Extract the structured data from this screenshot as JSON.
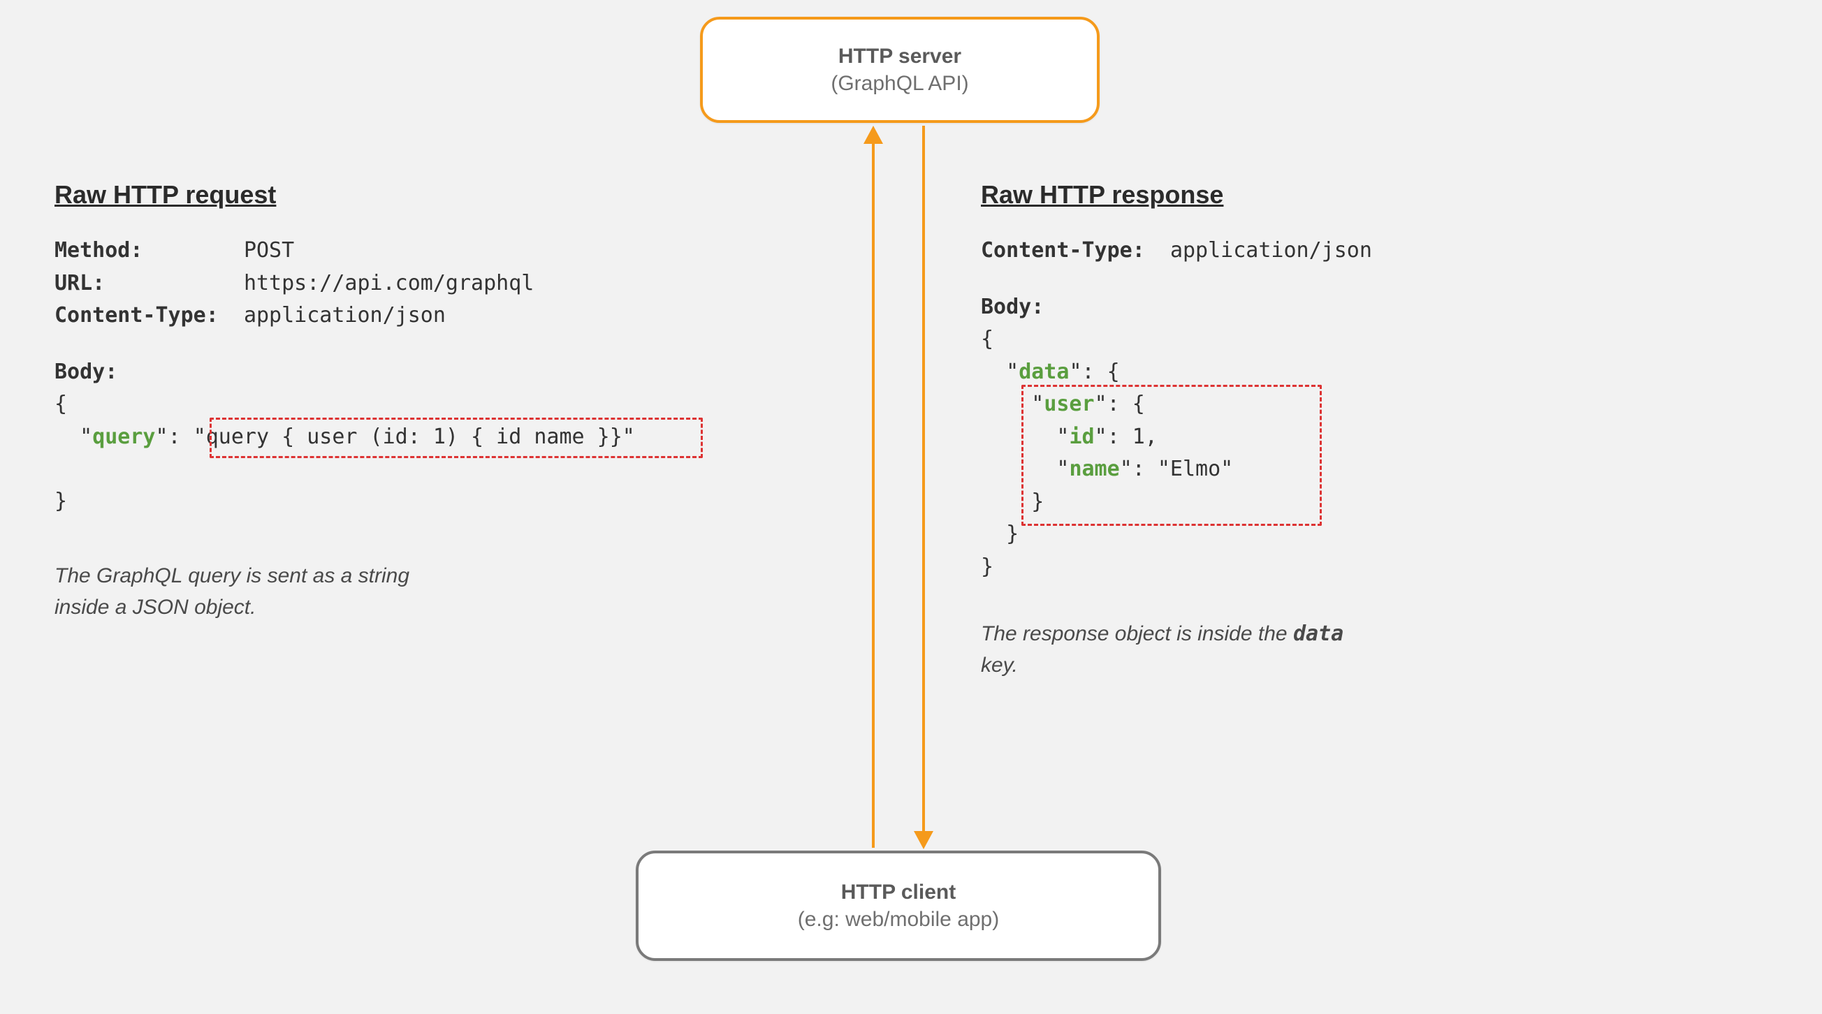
{
  "server": {
    "title": "HTTP server",
    "subtitle": "(GraphQL API)"
  },
  "client": {
    "title": "HTTP client",
    "subtitle": "(e.g: web/mobile app)"
  },
  "request": {
    "heading": "Raw HTTP request",
    "method_label": "Method:",
    "method_value": "POST",
    "url_label": "URL:",
    "url_value": "https://api.com/graphql",
    "content_type_label": "Content-Type:",
    "content_type_value": "application/json",
    "body_label": "Body:",
    "body_open": "{",
    "body_query_key_quote_open": "\"",
    "body_query_key": "query",
    "body_query_key_quote_close_colon": "\": ",
    "body_query_value": "\"query { user (id: 1) { id name }}\"",
    "body_close": "}",
    "caption_line1": "The GraphQL query is sent as a string",
    "caption_line2": "inside a JSON object."
  },
  "response": {
    "heading": "Raw HTTP response",
    "content_type_label": "Content-Type:",
    "content_type_value": "application/json",
    "body_label": "Body:",
    "l1": "{",
    "l2_pre_quote": "  \"",
    "l2_key": "data",
    "l2_post": "\": {",
    "l3_pre_quote": "    \"",
    "l3_key": "user",
    "l3_post": "\": {",
    "l4_pre_quote": "      \"",
    "l4_key": "id",
    "l4_post": "\": 1,",
    "l5_pre_quote": "      \"",
    "l5_key": "name",
    "l5_post": "\": \"Elmo\"",
    "l6": "    }",
    "l7": "  }",
    "l8": "}",
    "caption_pre": "The response object is inside the ",
    "caption_emph": "data",
    "caption_post": "key."
  },
  "colors": {
    "accent": "#f59a1b",
    "highlight_border": "#d33",
    "json_key": "#5a9e3f"
  }
}
